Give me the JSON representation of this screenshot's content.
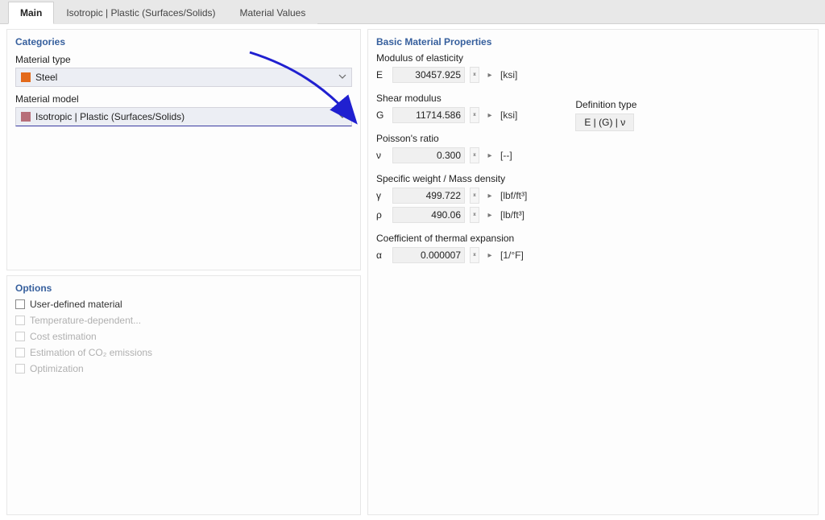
{
  "tabs": {
    "main": "Main",
    "iso": "Isotropic | Plastic (Surfaces/Solids)",
    "values": "Material Values"
  },
  "categories": {
    "title": "Categories",
    "material_type_label": "Material type",
    "material_type_value": "Steel",
    "material_model_label": "Material model",
    "material_model_value": "Isotropic | Plastic (Surfaces/Solids)"
  },
  "options": {
    "title": "Options",
    "user_defined": "User-defined material",
    "temp_dep": "Temperature-dependent...",
    "cost_est": "Cost estimation",
    "co2": "Estimation of CO₂ emissions",
    "optimization": "Optimization"
  },
  "props": {
    "title": "Basic Material Properties",
    "modulus_label": "Modulus of elasticity",
    "E_sym": "E",
    "E_val": "30457.925",
    "E_unit": "[ksi]",
    "shear_label": "Shear modulus",
    "G_sym": "G",
    "G_val": "11714.586",
    "G_unit": "[ksi]",
    "def_type_label": "Definition type",
    "def_type_value": "E | (G) | ν",
    "poisson_label": "Poisson's ratio",
    "nu_sym": "ν",
    "nu_val": "0.300",
    "nu_unit": "[--]",
    "specific_label": "Specific weight / Mass density",
    "gamma_sym": "γ",
    "gamma_val": "499.722",
    "gamma_unit": "[lbf/ft³]",
    "rho_sym": "ρ",
    "rho_val": "490.06",
    "rho_unit": "[lb/ft³]",
    "thermal_label": "Coefficient of thermal expansion",
    "alpha_sym": "α",
    "alpha_val": "0.000007",
    "alpha_unit": "[1/°F]"
  }
}
